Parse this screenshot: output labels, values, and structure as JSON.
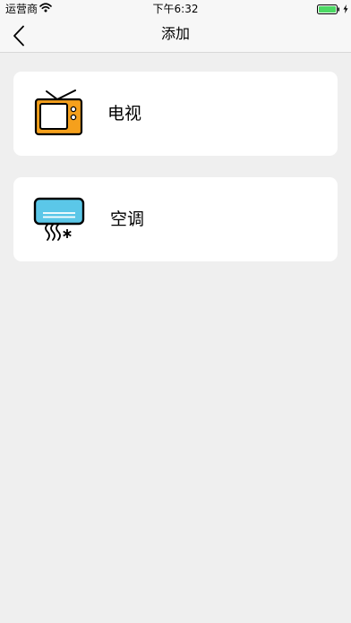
{
  "status_bar": {
    "carrier": "运营商",
    "time": "下午6:32"
  },
  "nav": {
    "title": "添加",
    "back_icon": "chevron-left-icon"
  },
  "devices": [
    {
      "label": "电视",
      "icon": "tv-icon",
      "color": "#f5a01c"
    },
    {
      "label": "空调",
      "icon": "air-conditioner-icon",
      "color": "#5bc7e8"
    }
  ],
  "colors": {
    "background": "#efefef",
    "card": "#ffffff",
    "battery": "#4cd964"
  }
}
